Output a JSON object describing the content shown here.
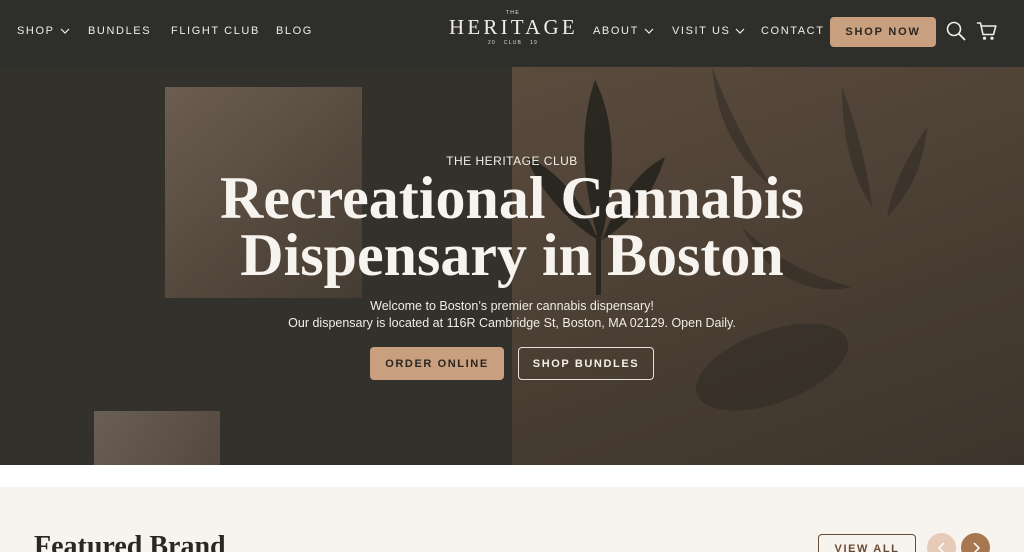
{
  "header": {
    "nav_left": {
      "shop": "SHOP",
      "bundles": "BUNDLES",
      "flight_club": "FLIGHT CLUB",
      "blog": "BLOG"
    },
    "logo": {
      "the": "THE",
      "name": "HERITAGE",
      "sub_left": "20",
      "sub_mid": "CLUB",
      "sub_right": "19"
    },
    "nav_right": {
      "about": "ABOUT",
      "visit_us": "VISIT US",
      "contact": "CONTACT"
    },
    "shop_now": "SHOP NOW",
    "icons": [
      "search-icon",
      "cart-icon",
      "chevron-down-icon"
    ]
  },
  "hero": {
    "eyebrow": "THE HERITAGE CLUB",
    "title_line1": "Recreational Cannabis",
    "title_line2": "Dispensary in Boston",
    "desc_line1": "Welcome to Boston’s premier cannabis dispensary!",
    "desc_line2": "Our dispensary is located at 116R Cambridge St, Boston, MA 02129. Open Daily.",
    "order_online": "ORDER ONLINE",
    "shop_bundles": "SHOP BUNDLES"
  },
  "featured": {
    "title": "Featured Brand",
    "view_all": "VIEW ALL",
    "icons": [
      "arrow-left-icon",
      "arrow-right-icon"
    ]
  },
  "colors": {
    "header_bg": "#2e2e2a",
    "accent": "#c9a07f",
    "brown": "#6b4a32",
    "page_bg": "#f7f3ef"
  }
}
